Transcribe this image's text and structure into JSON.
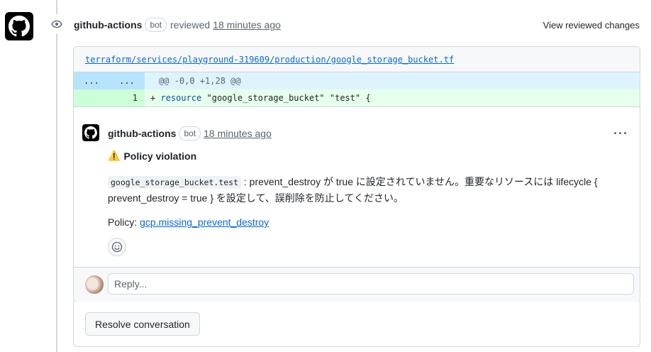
{
  "review": {
    "author": "github-actions",
    "bot_label": "bot",
    "action": "reviewed",
    "time": "18 minutes ago",
    "view_changes": "View reviewed changes"
  },
  "file": {
    "path": "terraform/services/playground-319609/production/google_storage_bucket.tf"
  },
  "diff": {
    "hunk_left": "...",
    "hunk_right": "...",
    "hunk_header": "@@ -0,0 +1,28 @@",
    "line_number": "1",
    "line_sign": "+",
    "line_keyword": "resource",
    "line_rest": " \"google_storage_bucket\" \"test\" {"
  },
  "comment": {
    "author": "github-actions",
    "bot_label": "bot",
    "time": "18 minutes ago",
    "menu": "···",
    "title_icon": "⚠️",
    "title": "Policy violation",
    "body_code": "google_storage_bucket.test",
    "body_text": " : prevent_destroy が true に設定されていません。重要なリソースには lifecycle { prevent_destroy = true } を設定して、誤削除を防止してください。",
    "policy_label": "Policy: ",
    "policy_link": "gcp.missing_prevent_destroy"
  },
  "reply": {
    "placeholder": "Reply..."
  },
  "resolve": {
    "label": "Resolve conversation"
  },
  "icons": {
    "bot_avatar": "github-mark-icon",
    "timeline": "eye-icon",
    "reaction": "smiley-icon"
  }
}
